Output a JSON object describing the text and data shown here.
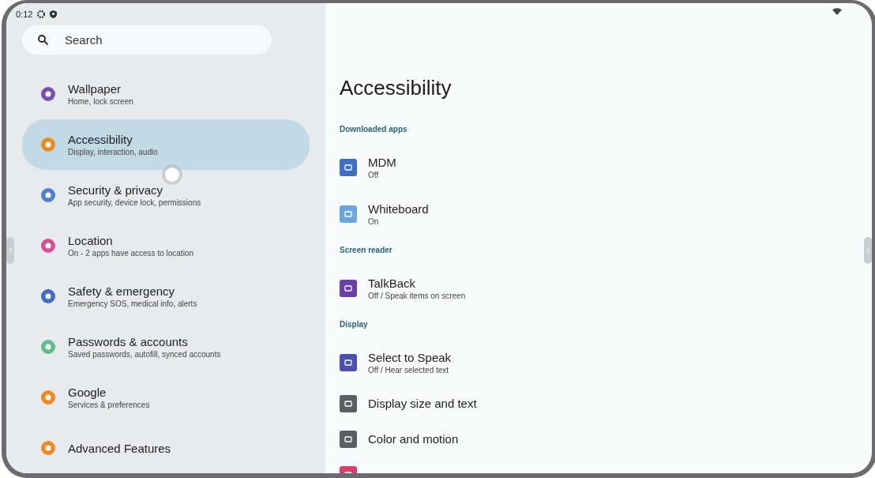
{
  "status_bar": {
    "time": "0:12"
  },
  "search": {
    "placeholder": "Search"
  },
  "sidebar": {
    "items": [
      {
        "title": "Wallpaper",
        "subtitle": "Home, lock screen",
        "color": "#7b4fb0",
        "selected": false
      },
      {
        "title": "Accessibility",
        "subtitle": "Display, interaction, audio",
        "color": "#ef8a1f",
        "selected": true
      },
      {
        "title": "Security & privacy",
        "subtitle": "App security, device lock, permissions",
        "color": "#4f7fd0",
        "selected": false
      },
      {
        "title": "Location",
        "subtitle": "On - 2 apps have access to location",
        "color": "#d64f9a",
        "selected": false
      },
      {
        "title": "Safety & emergency",
        "subtitle": "Emergency SOS, medical info, alerts",
        "color": "#3f6cc4",
        "selected": false
      },
      {
        "title": "Passwords & accounts",
        "subtitle": "Saved passwords, autofill, synced accounts",
        "color": "#5fbf8a",
        "selected": false
      },
      {
        "title": "Google",
        "subtitle": "Services & preferences",
        "color": "#ef8a1f",
        "selected": false
      },
      {
        "title": "Advanced Features",
        "color": "#ef8a1f",
        "selected": false
      }
    ]
  },
  "page": {
    "title": "Accessibility",
    "sections": [
      {
        "header": "Downloaded apps",
        "items": [
          {
            "title": "MDM",
            "subtitle": "Off",
            "color": "#3d6fc8"
          },
          {
            "title": "Whiteboard",
            "subtitle": "On",
            "color": "#6aa7e0"
          }
        ]
      },
      {
        "header": "Screen reader",
        "items": [
          {
            "title": "TalkBack",
            "subtitle": "Off / Speak items on screen",
            "color": "#6a3fa8"
          }
        ]
      },
      {
        "header": "Display",
        "items": [
          {
            "title": "Select to Speak",
            "subtitle": "Off / Hear selected text",
            "color": "#4a4fb0"
          },
          {
            "title": "Display size and text",
            "color": "#5a5f66"
          },
          {
            "title": "Color and motion",
            "color": "#5a5f66"
          },
          {
            "color": "#d8406a"
          }
        ]
      }
    ]
  }
}
